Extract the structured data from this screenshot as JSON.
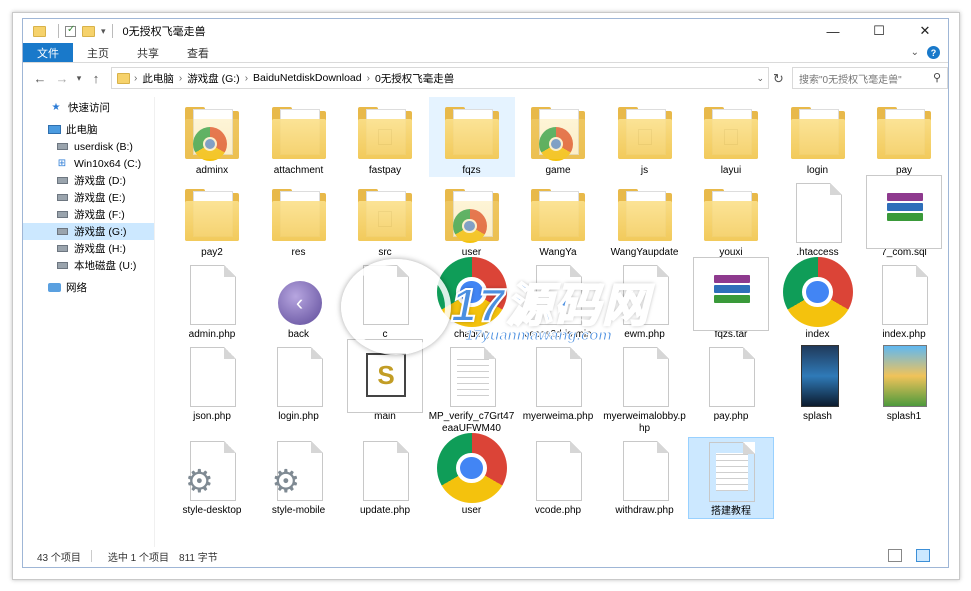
{
  "window": {
    "title": "0无授权飞毫走兽",
    "minimize": "—",
    "maximize": "☐",
    "close": "✕"
  },
  "ribbon": {
    "tabs": [
      "文件",
      "主页",
      "共享",
      "查看"
    ]
  },
  "nav": {
    "breadcrumb": [
      "此电脑",
      "游戏盘 (G:)",
      "BaiduNetdiskDownload",
      "0无授权飞毫走兽"
    ],
    "search_placeholder": "搜索\"0无授权飞毫走兽\""
  },
  "sidebar": {
    "items": [
      {
        "label": "快速访问",
        "icon": "star-icon"
      },
      {
        "label": "此电脑",
        "icon": "computer-icon"
      },
      {
        "label": "userdisk (B:)",
        "icon": "drive-icon"
      },
      {
        "label": "Win10x64 (C:)",
        "icon": "windows-drive-icon"
      },
      {
        "label": "游戏盘 (D:)",
        "icon": "drive-icon"
      },
      {
        "label": "游戏盘 (E:)",
        "icon": "drive-icon"
      },
      {
        "label": "游戏盘 (F:)",
        "icon": "drive-icon"
      },
      {
        "label": "游戏盘 (G:)",
        "icon": "drive-icon",
        "selected": true
      },
      {
        "label": "游戏盘 (H:)",
        "icon": "drive-icon"
      },
      {
        "label": "本地磁盘 (U:)",
        "icon": "drive-icon"
      },
      {
        "label": "网络",
        "icon": "network-icon"
      }
    ]
  },
  "files": [
    {
      "name": "adminx",
      "type": "folder-chrome"
    },
    {
      "name": "attachment",
      "type": "folder"
    },
    {
      "name": "fastpay",
      "type": "folder-doc"
    },
    {
      "name": "fqzs",
      "type": "folder-hover"
    },
    {
      "name": "game",
      "type": "folder-chrome"
    },
    {
      "name": "js",
      "type": "folder-doc"
    },
    {
      "name": "layui",
      "type": "folder-doc"
    },
    {
      "name": "login",
      "type": "folder"
    },
    {
      "name": "pay",
      "type": "folder"
    },
    {
      "name": "pay2",
      "type": "folder"
    },
    {
      "name": "res",
      "type": "folder"
    },
    {
      "name": "src",
      "type": "folder-doc"
    },
    {
      "name": "user",
      "type": "folder-chrome"
    },
    {
      "name": "WangYa",
      "type": "folder"
    },
    {
      "name": "WangYaupdate",
      "type": "folder"
    },
    {
      "name": "youxi",
      "type": "folder"
    },
    {
      "name": ".htaccess",
      "type": "file"
    },
    {
      "name": "7_com.sql",
      "type": "rar"
    },
    {
      "name": "admin.php",
      "type": "file"
    },
    {
      "name": "back",
      "type": "back"
    },
    {
      "name": "c",
      "type": "file"
    },
    {
      "name": "chading",
      "type": "chrome"
    },
    {
      "name": "cocos2d-js-min",
      "type": "file"
    },
    {
      "name": "ewm.php",
      "type": "file"
    },
    {
      "name": "fqzs.tar",
      "type": "rar"
    },
    {
      "name": "index",
      "type": "chrome"
    },
    {
      "name": "index.php",
      "type": "file"
    },
    {
      "name": "json.php",
      "type": "file"
    },
    {
      "name": "login.php",
      "type": "file"
    },
    {
      "name": "main",
      "type": "script"
    },
    {
      "name": "MP_verify_c7Grt47eaaUFWM40",
      "type": "text"
    },
    {
      "name": "myerweima.php",
      "type": "file"
    },
    {
      "name": "myerweimalobby.php",
      "type": "file"
    },
    {
      "name": "pay.php",
      "type": "file"
    },
    {
      "name": "splash",
      "type": "splash"
    },
    {
      "name": "splash1",
      "type": "splash1"
    },
    {
      "name": "style-desktop",
      "type": "gear"
    },
    {
      "name": "style-mobile",
      "type": "gear"
    },
    {
      "name": "update.php",
      "type": "file"
    },
    {
      "name": "user",
      "type": "chrome"
    },
    {
      "name": "vcode.php",
      "type": "file"
    },
    {
      "name": "withdraw.php",
      "type": "file"
    },
    {
      "name": "搭建教程",
      "type": "text-selected"
    }
  ],
  "status": {
    "count": "43 个项目",
    "selected": "选中 1 个项目",
    "size": "811 字节"
  },
  "watermark": {
    "main": "17源码网",
    "sub": "17yuanmawang.com"
  }
}
